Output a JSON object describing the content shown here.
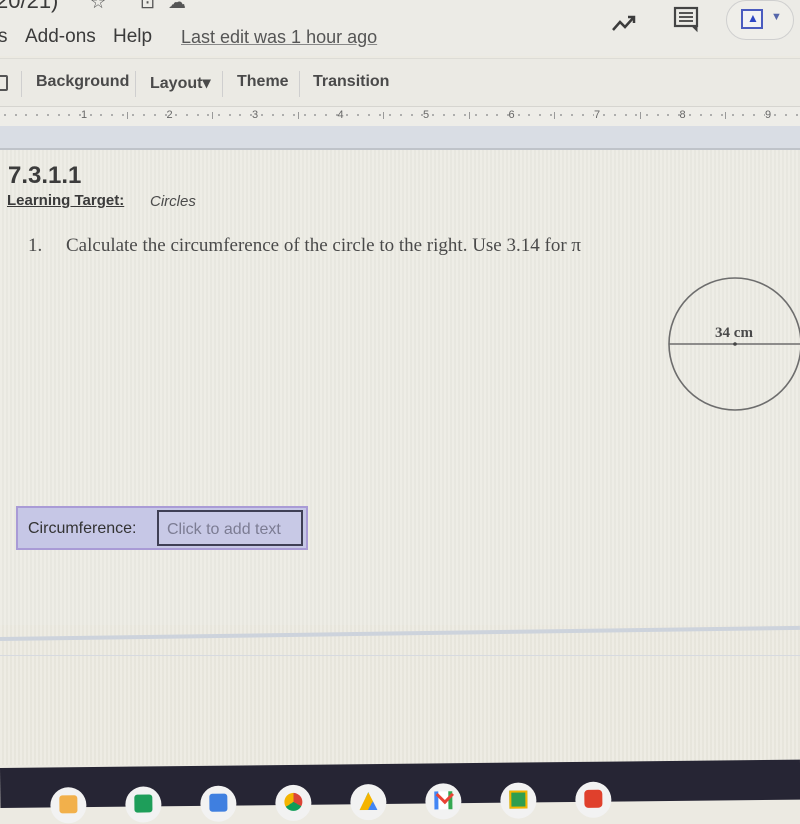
{
  "window": {
    "doc_title_fragment": "20/21)",
    "title_icons": [
      "star-icon",
      "move-to-folder-icon",
      "cloud-status-icon"
    ]
  },
  "menubar": {
    "items": [
      {
        "label": "s"
      },
      {
        "label": "Add-ons"
      },
      {
        "label": "Help"
      }
    ],
    "last_edit": "Last edit was 1 hour ago",
    "right_icons": [
      "activity-icon",
      "comment-icon",
      "present-icon"
    ]
  },
  "toolbar": {
    "items": [
      {
        "label": "Background"
      },
      {
        "label": "Layout",
        "has_dropdown": true
      },
      {
        "label": "Theme"
      },
      {
        "label": "Transition"
      }
    ],
    "layout_caret": "▾"
  },
  "ruler": {
    "numbers": [
      "1",
      "2",
      "3",
      "4",
      "5",
      "6",
      "7",
      "8",
      "9"
    ]
  },
  "slide": {
    "lesson_number": "7.3.1.1",
    "learning_target_label": "Learning Target:",
    "learning_target_value": "Circles",
    "question_number": "1.",
    "question_text": "Calculate the circumference of the circle to the right.  Use 3.14 for π",
    "figure": {
      "diameter_label": "34 cm"
    },
    "answer": {
      "label": "Circumference:",
      "placeholder": "Click to add text"
    }
  },
  "taskbar": {
    "apps": [
      "files-app",
      "sheets-app",
      "docs-app",
      "chrome-app",
      "drive-app",
      "gmail-app",
      "classroom-app",
      "youtube-app"
    ]
  },
  "colors": {
    "answer_fill": "#c6c7e6",
    "answer_border": "#a99bd6",
    "present_accent": "#2d46c4",
    "taskbar": "#262534"
  }
}
